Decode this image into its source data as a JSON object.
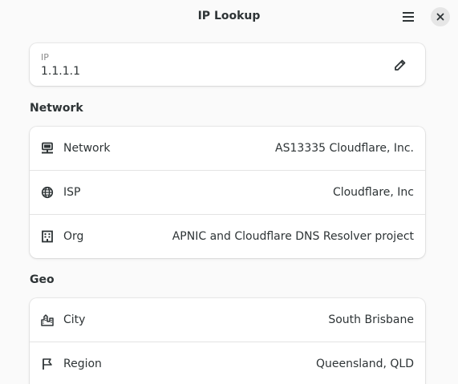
{
  "window": {
    "title": "IP Lookup"
  },
  "header": {
    "menu_icon": "hamburger-menu-icon",
    "close_icon": "close-icon"
  },
  "ip_entry": {
    "label": "IP",
    "value": "1.1.1.1",
    "edit_icon": "pencil-icon"
  },
  "network": {
    "heading": "Network",
    "rows": [
      {
        "icon": "network-computer-icon",
        "label": "Network",
        "value": "AS13335 Cloudflare, Inc."
      },
      {
        "icon": "globe-icon",
        "label": "ISP",
        "value": "Cloudflare, Inc"
      },
      {
        "icon": "building-icon",
        "label": "Org",
        "value": "APNIC and Cloudflare DNS Resolver project"
      }
    ]
  },
  "geo": {
    "heading": "Geo",
    "rows": [
      {
        "icon": "city-icon",
        "label": "City",
        "value": "South Brisbane"
      },
      {
        "icon": "flag-icon",
        "label": "Region",
        "value": "Queensland, QLD"
      }
    ]
  }
}
